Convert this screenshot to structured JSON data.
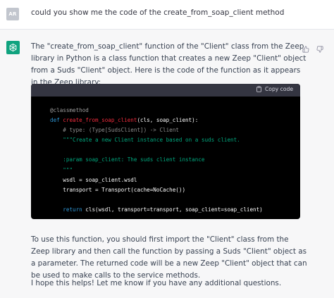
{
  "user_message": {
    "avatar_initials": "AR",
    "text": "could you show me the code of the create_from_soap_client method"
  },
  "assistant_message": {
    "paragraph_1": "The \"create_from_soap_client\" function of the \"Client\" class from the Zeep library in Python is a class function that creates a new Zeep \"Client\" object from a Suds \"Client\" object. Here is the code of the function as it appears in the Zeep library:",
    "paragraph_2": "To use this function, you should first import the \"Client\" class from the Zeep library and then call the function by passing a Suds \"Client\" object as a parameter. The returned code will be a new Zeep \"Client\" object that can be used to make calls to the service methods.",
    "paragraph_3": "I hope this helps! Let me know if you have any additional questions."
  },
  "code_block": {
    "copy_label": "Copy code",
    "lines": {
      "l1_decorator": "@classmethod",
      "l2_def": "def ",
      "l2_name": "create_from_soap_client",
      "l2_args": "(cls, soap_client):",
      "l3_comment": "# type: (Type[SudsClient]) -> Client",
      "l4_doc": "\"\"\"Create a new Client instance based on a suds client.",
      "l6_doc": ":param soap_client: The suds client instance",
      "l7_doc": "\"\"\"",
      "l8_code": "wsdl = soap_client.wsdl",
      "l9_code": "transport = Transport(cache=NoCache())",
      "l11_return": "return",
      "l11_code": " cls(wsdl, transport=transport, soap_client=soap_client)"
    }
  },
  "colors": {
    "assistant_avatar": "#10a37f",
    "code_background": "#000000",
    "code_header": "#343541",
    "keyword": "#2e95d3",
    "function_name": "#f22c3d",
    "string": "#00a67d"
  },
  "icons": [
    "thumbs-up-icon",
    "thumbs-down-icon",
    "clipboard-icon",
    "openai-logo-icon"
  ]
}
